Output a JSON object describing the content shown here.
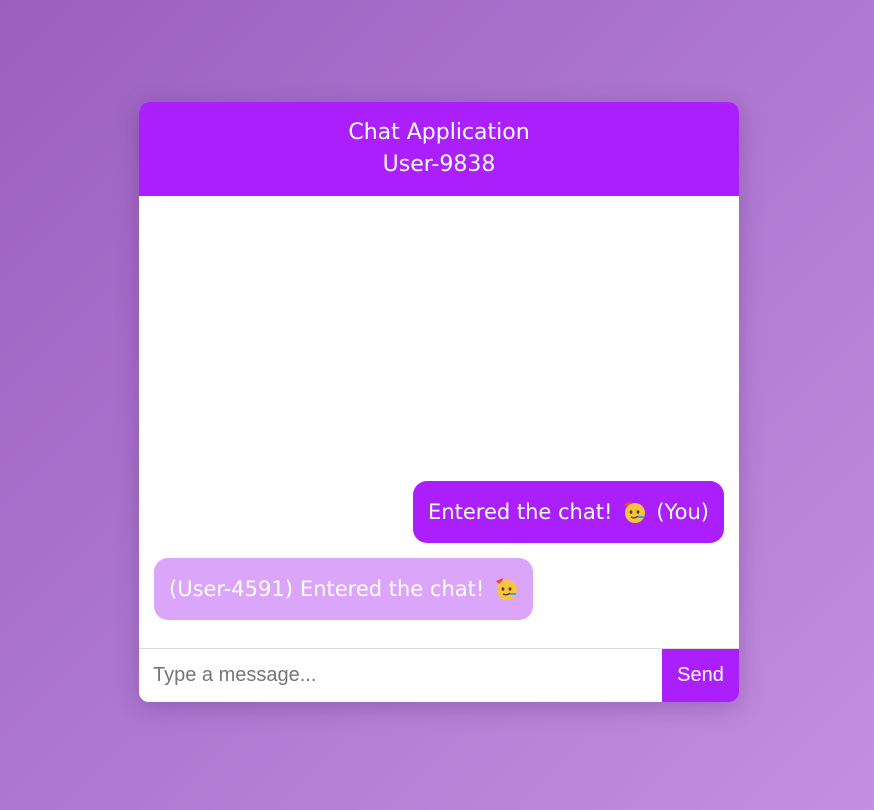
{
  "header": {
    "title": "Chat Application",
    "user": "User-9838"
  },
  "messages": [
    {
      "sender": "self",
      "text": "Entered the chat!",
      "emoji": "party-face-icon",
      "suffix": "(You)"
    },
    {
      "sender": "other",
      "prefix": "(User-4591)",
      "text": "Entered the chat!",
      "emoji": "party-face-icon"
    }
  ],
  "input": {
    "placeholder": "Type a message...",
    "value": ""
  },
  "send_label": "Send",
  "colors": {
    "accent": "#aa1ffb",
    "other_bubble": "#dba6f9"
  }
}
